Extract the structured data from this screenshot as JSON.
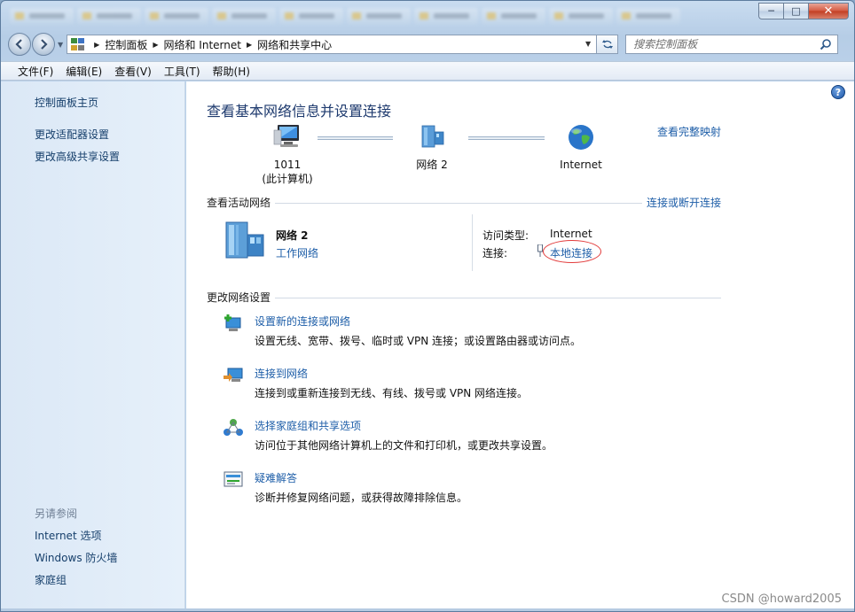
{
  "window": {
    "caption": {
      "minimize": "─",
      "maximize": "□",
      "close": "✕"
    }
  },
  "nav": {
    "back_icon": "back-arrow-icon",
    "forward_icon": "forward-arrow-icon",
    "breadcrumbs": [
      "控制面板",
      "网络和 Internet",
      "网络和共享中心"
    ],
    "search_placeholder": "搜索控制面板"
  },
  "menubar": {
    "items": [
      "文件(F)",
      "编辑(E)",
      "查看(V)",
      "工具(T)",
      "帮助(H)"
    ]
  },
  "sidebar": {
    "links": [
      "控制面板主页",
      "更改适配器设置",
      "更改高级共享设置"
    ],
    "see_also_label": "另请参阅",
    "see_also": [
      "Internet 选项",
      "Windows 防火墙",
      "家庭组"
    ]
  },
  "main": {
    "title": "查看基本网络信息并设置连接",
    "map_link": "查看完整映射",
    "nodes": [
      {
        "label": "1011",
        "sub": "(此计算机)",
        "icon": "computer-icon"
      },
      {
        "label": "网络  2",
        "sub": "",
        "icon": "network-icon"
      },
      {
        "label": "Internet",
        "sub": "",
        "icon": "globe-icon"
      }
    ],
    "active_section": {
      "heading": "查看活动网络",
      "action_link": "连接或断开连接",
      "network_name": "网络  2",
      "network_type": "工作网络",
      "access_type_label": "访问类型:",
      "access_type_value": "Internet",
      "connection_label": "连接:",
      "connection_value": "本地连接"
    },
    "change_section": {
      "heading": "更改网络设置",
      "tasks": [
        {
          "title": "设置新的连接或网络",
          "desc": "设置无线、宽带、拨号、临时或 VPN 连接；或设置路由器或访问点。",
          "icon": "new-connection-icon"
        },
        {
          "title": "连接到网络",
          "desc": "连接到或重新连接到无线、有线、拨号或 VPN 网络连接。",
          "icon": "connect-network-icon"
        },
        {
          "title": "选择家庭组和共享选项",
          "desc": "访问位于其他网络计算机上的文件和打印机，或更改共享设置。",
          "icon": "homegroup-icon"
        },
        {
          "title": "疑难解答",
          "desc": "诊断并修复网络问题，或获得故障排除信息。",
          "icon": "troubleshoot-icon"
        }
      ]
    }
  },
  "watermark": "CSDN @howard2005"
}
